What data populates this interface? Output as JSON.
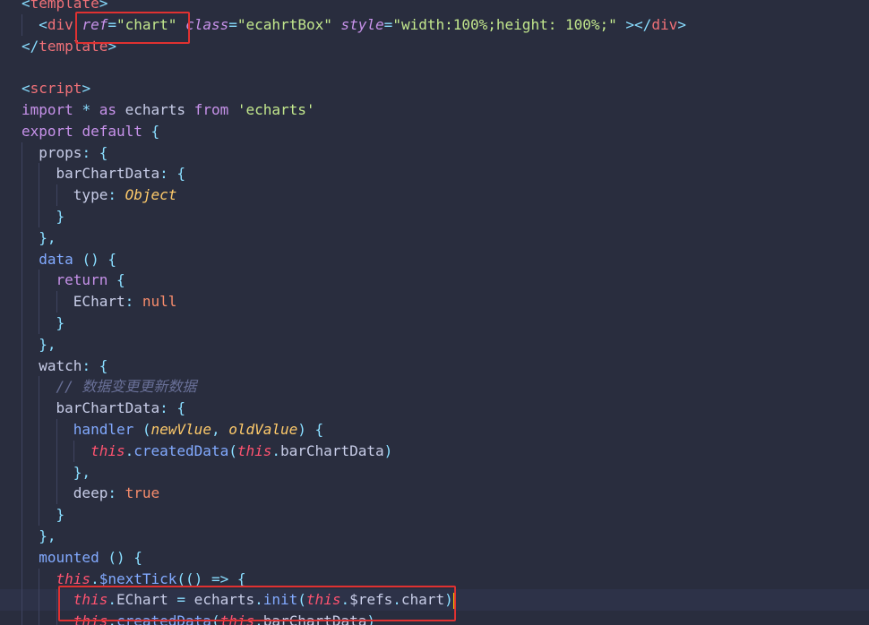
{
  "lines": [
    [
      {
        "c": "t-pun",
        "t": "<"
      },
      {
        "c": "t-tag",
        "t": "template"
      },
      {
        "c": "t-pun",
        "t": ">"
      }
    ],
    [
      {
        "c": "t-plain",
        "t": "  "
      },
      {
        "c": "t-pun",
        "t": "<"
      },
      {
        "c": "t-tag",
        "t": "div"
      },
      {
        "c": "t-plain",
        "t": " "
      },
      {
        "c": "t-attr",
        "t": "ref"
      },
      {
        "c": "t-pun",
        "t": "="
      },
      {
        "c": "t-str",
        "t": "\"chart\""
      },
      {
        "c": "t-plain",
        "t": " "
      },
      {
        "c": "t-attr",
        "t": "class"
      },
      {
        "c": "t-pun",
        "t": "="
      },
      {
        "c": "t-str",
        "t": "\"ecahrtBox\""
      },
      {
        "c": "t-plain",
        "t": " "
      },
      {
        "c": "t-attr",
        "t": "style"
      },
      {
        "c": "t-pun",
        "t": "="
      },
      {
        "c": "t-str",
        "t": "\"width:100%;height: 100%;\""
      },
      {
        "c": "t-plain",
        "t": " "
      },
      {
        "c": "t-pun",
        "t": "></"
      },
      {
        "c": "t-tag",
        "t": "div"
      },
      {
        "c": "t-pun",
        "t": ">"
      }
    ],
    [
      {
        "c": "t-pun",
        "t": "</"
      },
      {
        "c": "t-tag",
        "t": "template"
      },
      {
        "c": "t-pun",
        "t": ">"
      }
    ],
    [],
    [
      {
        "c": "t-pun",
        "t": "<"
      },
      {
        "c": "t-tag",
        "t": "script"
      },
      {
        "c": "t-pun",
        "t": ">"
      }
    ],
    [
      {
        "c": "t-kw",
        "t": "import"
      },
      {
        "c": "t-plain",
        "t": " "
      },
      {
        "c": "t-op",
        "t": "*"
      },
      {
        "c": "t-plain",
        "t": " "
      },
      {
        "c": "t-kw",
        "t": "as"
      },
      {
        "c": "t-plain",
        "t": " echarts "
      },
      {
        "c": "t-kw",
        "t": "from"
      },
      {
        "c": "t-plain",
        "t": " "
      },
      {
        "c": "t-str",
        "t": "'echarts'"
      }
    ],
    [
      {
        "c": "t-kw",
        "t": "export"
      },
      {
        "c": "t-plain",
        "t": " "
      },
      {
        "c": "t-kw",
        "t": "default"
      },
      {
        "c": "t-plain",
        "t": " "
      },
      {
        "c": "t-pun",
        "t": "{"
      }
    ],
    [
      {
        "c": "t-plain",
        "t": "  "
      },
      {
        "c": "t-prop",
        "t": "props"
      },
      {
        "c": "t-pun",
        "t": ": {"
      }
    ],
    [
      {
        "c": "t-plain",
        "t": "    "
      },
      {
        "c": "t-prop",
        "t": "barChartData"
      },
      {
        "c": "t-pun",
        "t": ": {"
      }
    ],
    [
      {
        "c": "t-plain",
        "t": "      "
      },
      {
        "c": "t-prop",
        "t": "type"
      },
      {
        "c": "t-pun",
        "t": ": "
      },
      {
        "c": "t-type",
        "t": "Object"
      }
    ],
    [
      {
        "c": "t-plain",
        "t": "    "
      },
      {
        "c": "t-pun",
        "t": "}"
      }
    ],
    [
      {
        "c": "t-plain",
        "t": "  "
      },
      {
        "c": "t-pun",
        "t": "},"
      }
    ],
    [
      {
        "c": "t-plain",
        "t": "  "
      },
      {
        "c": "t-fn",
        "t": "data"
      },
      {
        "c": "t-plain",
        "t": " "
      },
      {
        "c": "t-pun",
        "t": "() {"
      }
    ],
    [
      {
        "c": "t-plain",
        "t": "    "
      },
      {
        "c": "t-kw",
        "t": "return"
      },
      {
        "c": "t-plain",
        "t": " "
      },
      {
        "c": "t-pun",
        "t": "{"
      }
    ],
    [
      {
        "c": "t-plain",
        "t": "      "
      },
      {
        "c": "t-prop",
        "t": "EChart"
      },
      {
        "c": "t-pun",
        "t": ": "
      },
      {
        "c": "t-const",
        "t": "null"
      }
    ],
    [
      {
        "c": "t-plain",
        "t": "    "
      },
      {
        "c": "t-pun",
        "t": "}"
      }
    ],
    [
      {
        "c": "t-plain",
        "t": "  "
      },
      {
        "c": "t-pun",
        "t": "},"
      }
    ],
    [
      {
        "c": "t-plain",
        "t": "  "
      },
      {
        "c": "t-prop",
        "t": "watch"
      },
      {
        "c": "t-pun",
        "t": ": {"
      }
    ],
    [
      {
        "c": "t-plain",
        "t": "    "
      },
      {
        "c": "t-cmt",
        "t": "// 数据变更更新数据"
      }
    ],
    [
      {
        "c": "t-plain",
        "t": "    "
      },
      {
        "c": "t-prop",
        "t": "barChartData"
      },
      {
        "c": "t-pun",
        "t": ": {"
      }
    ],
    [
      {
        "c": "t-plain",
        "t": "      "
      },
      {
        "c": "t-fn",
        "t": "handler"
      },
      {
        "c": "t-plain",
        "t": " "
      },
      {
        "c": "t-pun",
        "t": "("
      },
      {
        "c": "t-param",
        "t": "newVlue"
      },
      {
        "c": "t-pun",
        "t": ", "
      },
      {
        "c": "t-param",
        "t": "oldValue"
      },
      {
        "c": "t-pun",
        "t": ") {"
      }
    ],
    [
      {
        "c": "t-plain",
        "t": "        "
      },
      {
        "c": "t-this",
        "t": "this"
      },
      {
        "c": "t-pun",
        "t": "."
      },
      {
        "c": "t-fn",
        "t": "createdData"
      },
      {
        "c": "t-pun",
        "t": "("
      },
      {
        "c": "t-this",
        "t": "this"
      },
      {
        "c": "t-pun",
        "t": "."
      },
      {
        "c": "t-plain",
        "t": "barChartData"
      },
      {
        "c": "t-pun",
        "t": ")"
      }
    ],
    [
      {
        "c": "t-plain",
        "t": "      "
      },
      {
        "c": "t-pun",
        "t": "},"
      }
    ],
    [
      {
        "c": "t-plain",
        "t": "      "
      },
      {
        "c": "t-prop",
        "t": "deep"
      },
      {
        "c": "t-pun",
        "t": ": "
      },
      {
        "c": "t-const",
        "t": "true"
      }
    ],
    [
      {
        "c": "t-plain",
        "t": "    "
      },
      {
        "c": "t-pun",
        "t": "}"
      }
    ],
    [
      {
        "c": "t-plain",
        "t": "  "
      },
      {
        "c": "t-pun",
        "t": "},"
      }
    ],
    [
      {
        "c": "t-plain",
        "t": "  "
      },
      {
        "c": "t-fn",
        "t": "mounted"
      },
      {
        "c": "t-plain",
        "t": " "
      },
      {
        "c": "t-pun",
        "t": "() {"
      }
    ],
    [
      {
        "c": "t-plain",
        "t": "    "
      },
      {
        "c": "t-this",
        "t": "this"
      },
      {
        "c": "t-pun",
        "t": "."
      },
      {
        "c": "t-fn",
        "t": "$nextTick"
      },
      {
        "c": "t-pun",
        "t": "(() "
      },
      {
        "c": "t-op",
        "t": "=>"
      },
      {
        "c": "t-plain",
        "t": " "
      },
      {
        "c": "t-pun",
        "t": "{"
      }
    ],
    [
      {
        "c": "t-plain",
        "t": "      "
      },
      {
        "c": "t-this",
        "t": "this"
      },
      {
        "c": "t-pun",
        "t": "."
      },
      {
        "c": "t-plain",
        "t": "EChart "
      },
      {
        "c": "t-op",
        "t": "="
      },
      {
        "c": "t-plain",
        "t": " echarts"
      },
      {
        "c": "t-pun",
        "t": "."
      },
      {
        "c": "t-fn",
        "t": "init"
      },
      {
        "c": "t-pun",
        "t": "("
      },
      {
        "c": "t-this",
        "t": "this"
      },
      {
        "c": "t-pun",
        "t": "."
      },
      {
        "c": "t-plain",
        "t": "$refs"
      },
      {
        "c": "t-pun",
        "t": "."
      },
      {
        "c": "t-plain",
        "t": "chart"
      },
      {
        "c": "t-pun",
        "t": ")"
      }
    ],
    [
      {
        "c": "t-plain",
        "t": "      "
      },
      {
        "c": "t-this",
        "t": "this"
      },
      {
        "c": "t-pun",
        "t": "."
      },
      {
        "c": "t-fn",
        "t": "createdData"
      },
      {
        "c": "t-pun",
        "t": "("
      },
      {
        "c": "t-this",
        "t": "this"
      },
      {
        "c": "t-pun",
        "t": "."
      },
      {
        "c": "t-plain",
        "t": "barChartData"
      },
      {
        "c": "t-pun",
        "t": ")"
      }
    ]
  ],
  "highlights": {
    "ref_attribute": "ref=\"chart\"",
    "init_statement": "this.EChart = echarts.init(this.$refs.chart)"
  },
  "colors": {
    "background": "#292d3e",
    "highlight_border": "#e03131",
    "keyword": "#c792ea",
    "string": "#c3e88d",
    "function": "#82aaff",
    "this": "#ff5370"
  }
}
